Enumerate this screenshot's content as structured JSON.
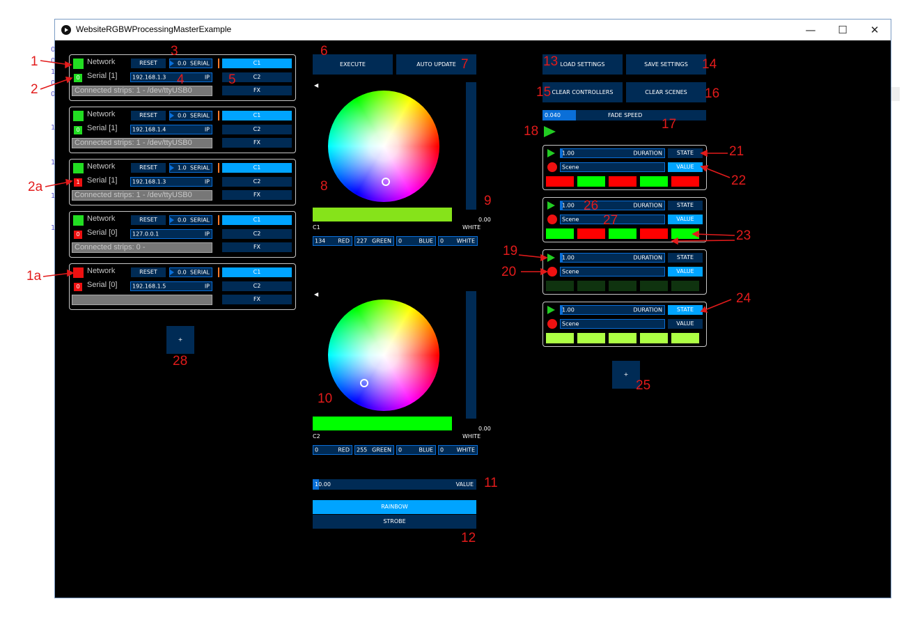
{
  "window": {
    "title": "WebsiteRGBWProcessingMasterExample"
  },
  "controllers": [
    {
      "status_color": "#22dd22",
      "network_label": "Network",
      "reset_label": "RESET",
      "serial_value": "0.0",
      "serial_label": "SERIAL",
      "badge": "0",
      "badge_color": "#22dd22",
      "serial_port_label": "Serial [1]",
      "ip_value": "192.168.1.3",
      "ip_label": "IP",
      "connected_text": "Connected strips: 1 - /dev/ttyUSB0",
      "c1_label": "C1",
      "c2_label": "C2",
      "fx_label": "FX"
    },
    {
      "status_color": "#22dd22",
      "network_label": "Network",
      "reset_label": "RESET",
      "serial_value": "0.0",
      "serial_label": "SERIAL",
      "badge": "0",
      "badge_color": "#22dd22",
      "serial_port_label": "Serial [1]",
      "ip_value": "192.168.1.4",
      "ip_label": "IP",
      "connected_text": "Connected strips: 1 - /dev/ttyUSB0",
      "c1_label": "C1",
      "c2_label": "C2",
      "fx_label": "FX"
    },
    {
      "status_color": "#22dd22",
      "network_label": "Network",
      "reset_label": "RESET",
      "serial_value": "1.0",
      "serial_label": "SERIAL",
      "badge": "1",
      "badge_color": "#ee1111",
      "serial_port_label": "Serial [1]",
      "ip_value": "192.168.1.3",
      "ip_label": "IP",
      "connected_text": "Connected strips: 1 - /dev/ttyUSB0",
      "c1_label": "C1",
      "c2_label": "C2",
      "fx_label": "FX"
    },
    {
      "status_color": "#22dd22",
      "network_label": "Network",
      "reset_label": "RESET",
      "serial_value": "0.0",
      "serial_label": "SERIAL",
      "badge": "0",
      "badge_color": "#ee1111",
      "serial_port_label": "Serial [0]",
      "ip_value": "127.0.0.1",
      "ip_label": "IP",
      "connected_text": "Connected strips: 0 -",
      "c1_label": "C1",
      "c2_label": "C2",
      "fx_label": "FX"
    },
    {
      "status_color": "#ee1111",
      "network_label": "Network",
      "reset_label": "RESET",
      "serial_value": "0.0",
      "serial_label": "SERIAL",
      "badge": "0",
      "badge_color": "#ee1111",
      "serial_port_label": "Serial [0]",
      "ip_value": "192.168.1.5",
      "ip_label": "IP",
      "connected_text": "",
      "c1_label": "C1",
      "c2_label": "C2",
      "fx_label": "FX"
    }
  ],
  "add_controller_label": "+",
  "center": {
    "execute_label": "EXECUTE",
    "auto_update_label": "AUTO UPDATE",
    "c1": {
      "label": "C1",
      "white_label": "WHITE",
      "white_value": "0.00",
      "swatch_color": "#86e31a",
      "red": "134",
      "red_label": "RED",
      "green": "227",
      "green_label": "GREEN",
      "blue": "0",
      "blue_label": "BLUE",
      "white": "0",
      "white_field_label": "WHITE"
    },
    "c2": {
      "label": "C2",
      "white_label": "WHITE",
      "white_value": "0.00",
      "swatch_color": "#00ff00",
      "red": "0",
      "red_label": "RED",
      "green": "255",
      "green_label": "GREEN",
      "blue": "0",
      "blue_label": "BLUE",
      "white": "0",
      "white_field_label": "WHITE"
    },
    "value_slider": {
      "value": "10.00",
      "label": "VALUE"
    },
    "rainbow_label": "RAINBOW",
    "strobe_label": "STROBE"
  },
  "right": {
    "load_settings_label": "LOAD SETTINGS",
    "save_settings_label": "SAVE SETTINGS",
    "clear_controllers_label": "CLEAR CONTROLLERS",
    "clear_scenes_label": "CLEAR SCENES",
    "fade_speed": {
      "value": "0.040",
      "label": "FADE SPEED"
    },
    "scenes": [
      {
        "duration_value": "1.00",
        "duration_label": "DURATION",
        "state_label": "STATE",
        "scene_name": "Scene",
        "value_label": "VALUE",
        "state_active": false,
        "value_active": true,
        "swatches": [
          "#ff0000",
          "#00ff00",
          "#ff0000",
          "#00ff00",
          "#ff0000"
        ]
      },
      {
        "duration_value": "1.00",
        "duration_label": "DURATION",
        "state_label": "STATE",
        "scene_name": "Scene",
        "value_label": "VALUE",
        "state_active": false,
        "value_active": true,
        "swatches": [
          "#00ff00",
          "#ff0000",
          "#00ff00",
          "#ff0000",
          "#00ff00"
        ]
      },
      {
        "duration_value": "1.00",
        "duration_label": "DURATION",
        "state_label": "STATE",
        "scene_name": "Scene",
        "value_label": "VALUE",
        "state_active": false,
        "value_active": true,
        "swatches": [
          "#0f330f",
          "#0f330f",
          "#0f330f",
          "#0f330f",
          "#0f330f"
        ]
      },
      {
        "duration_value": "1.00",
        "duration_label": "DURATION",
        "state_label": "STATE",
        "scene_name": "Scene",
        "value_label": "VALUE",
        "state_active": true,
        "value_active": false,
        "swatches": [
          "#adff44",
          "#adff44",
          "#adff44",
          "#adff44",
          "#adff44"
        ]
      }
    ],
    "add_scene_label": "+"
  },
  "annotations": [
    "1",
    "2",
    "2a",
    "1a",
    "3",
    "4",
    "5",
    "6",
    "7",
    "8",
    "9",
    "10",
    "11",
    "12",
    "13",
    "14",
    "15",
    "16",
    "17",
    "18",
    "19",
    "20",
    "21",
    "22",
    "23",
    "24",
    "25",
    "26",
    "27",
    "28"
  ]
}
